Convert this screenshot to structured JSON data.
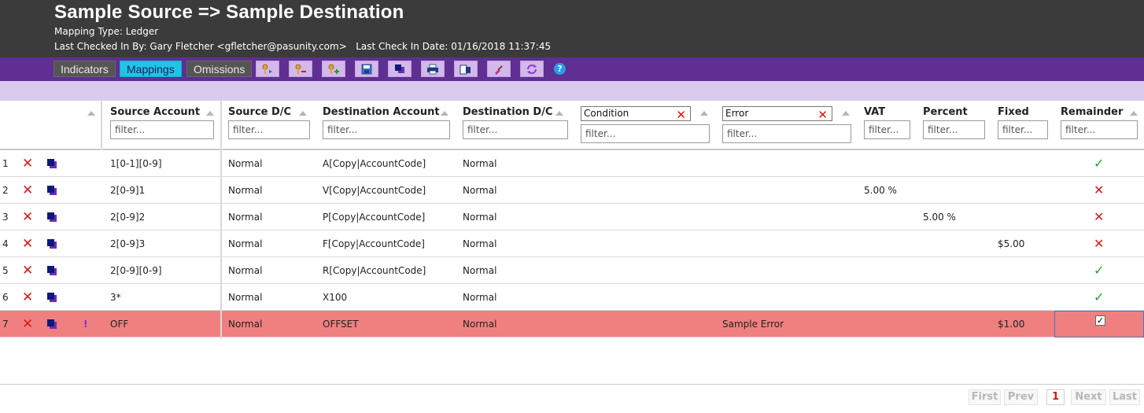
{
  "header": {
    "title": "Sample Source => Sample Destination",
    "mapping_type": "Mapping Type: Ledger",
    "checkin": "Last Checked In By: Gary Fletcher <gfletcher@pasunity.com>   Last Check In Date: 01/16/2018 11:37:45"
  },
  "toolbar": {
    "tabs": [
      "Indicators",
      "Mappings",
      "Omissions"
    ],
    "active_tab": "Mappings",
    "icons": [
      "key-import-icon",
      "key-remove-icon",
      "key-add-icon",
      "save-icon",
      "copy-icon",
      "print-icon",
      "export-icon",
      "clear-icon",
      "refresh-icon"
    ],
    "help": "?"
  },
  "grid": {
    "columns": {
      "source_account": "Source Account",
      "source_dc": "Source D/C",
      "dest_account": "Destination Account",
      "dest_dc": "Destination D/C",
      "condition": "Condition",
      "error": "Error",
      "vat": "VAT",
      "percent": "Percent",
      "fixed": "Fixed",
      "remainder": "Remainder"
    },
    "filter_placeholder": "filter...",
    "rows": [
      {
        "num": "1",
        "source": "1[0-1][0-9]",
        "sdc": "Normal",
        "dest": "A[Copy|AccountCode]",
        "ddc": "Normal",
        "error": "",
        "vat": "",
        "percent": "",
        "fixed": "",
        "remainder": "check"
      },
      {
        "num": "2",
        "source": "2[0-9]1",
        "sdc": "Normal",
        "dest": "V[Copy|AccountCode]",
        "ddc": "Normal",
        "error": "",
        "vat": "5.00 %",
        "percent": "",
        "fixed": "",
        "remainder": "cross"
      },
      {
        "num": "3",
        "source": "2[0-9]2",
        "sdc": "Normal",
        "dest": "P[Copy|AccountCode]",
        "ddc": "Normal",
        "error": "",
        "vat": "",
        "percent": "5.00 %",
        "fixed": "",
        "remainder": "cross"
      },
      {
        "num": "4",
        "source": "2[0-9]3",
        "sdc": "Normal",
        "dest": "F[Copy|AccountCode]",
        "ddc": "Normal",
        "error": "",
        "vat": "",
        "percent": "",
        "fixed": "$5.00",
        "remainder": "cross"
      },
      {
        "num": "5",
        "source": "2[0-9][0-9]",
        "sdc": "Normal",
        "dest": "R[Copy|AccountCode]",
        "ddc": "Normal",
        "error": "",
        "vat": "",
        "percent": "",
        "fixed": "",
        "remainder": "check"
      },
      {
        "num": "6",
        "source": "3*",
        "sdc": "Normal",
        "dest": "X100",
        "ddc": "Normal",
        "error": "",
        "vat": "",
        "percent": "",
        "fixed": "",
        "remainder": "check"
      },
      {
        "num": "7",
        "source": "OFF",
        "sdc": "Normal",
        "dest": "OFFSET",
        "ddc": "Normal",
        "error": "Sample Error",
        "vat": "",
        "percent": "",
        "fixed": "$1.00",
        "remainder": "checkbox",
        "warning": "!"
      }
    ]
  },
  "pager": {
    "first": "First",
    "prev": "Prev",
    "current": "1",
    "next": "Next",
    "last": "Last"
  },
  "colors": {
    "header_bg": "#3b3b3b",
    "toolbar_bg": "#5f2f93",
    "active_tab": "#1fc5e6",
    "error_row": "#f08080",
    "delete_red": "#d41a1a",
    "check_green": "#22a32a"
  }
}
